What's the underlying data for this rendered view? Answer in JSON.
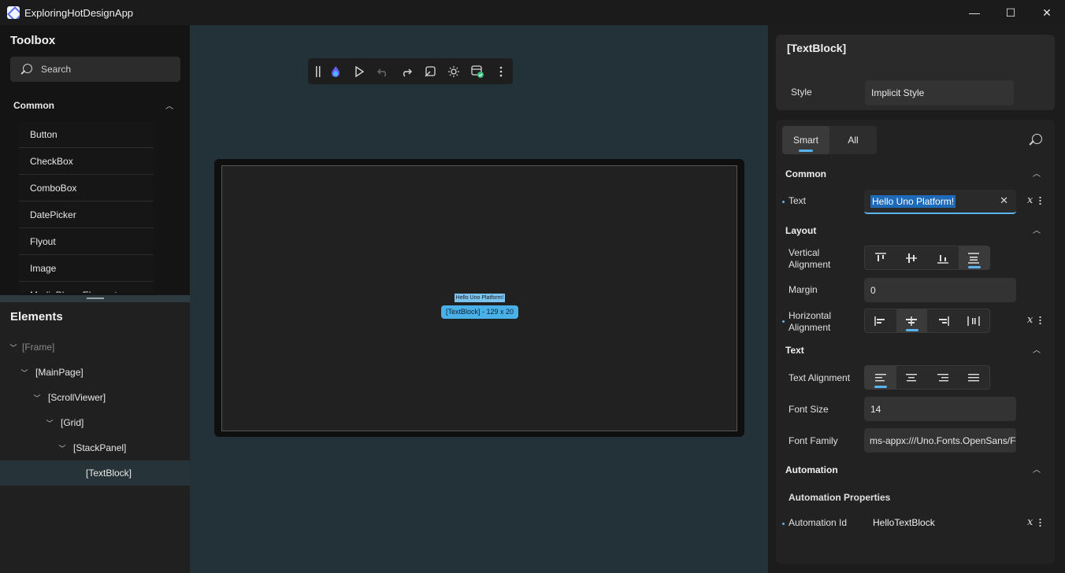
{
  "window": {
    "title": "ExploringHotDesignApp",
    "controls": {
      "minimize": "—",
      "maximize": "☐",
      "close": "✕"
    }
  },
  "toolbox": {
    "title": "Toolbox",
    "search_placeholder": "Search",
    "section": "Common",
    "items": [
      "Button",
      "CheckBox",
      "ComboBox",
      "DatePicker",
      "Flyout",
      "Image",
      "MediaPlayerElement"
    ]
  },
  "elements": {
    "title": "Elements",
    "tree": [
      {
        "label": "[Frame]",
        "depth": 0,
        "expanded": true,
        "dim": true
      },
      {
        "label": "[MainPage]",
        "depth": 1,
        "expanded": true
      },
      {
        "label": "[ScrollViewer]",
        "depth": 2,
        "expanded": true
      },
      {
        "label": "[Grid]",
        "depth": 3,
        "expanded": true
      },
      {
        "label": "[StackPanel]",
        "depth": 4,
        "expanded": true
      },
      {
        "label": "[TextBlock]",
        "depth": 5,
        "selected": true
      }
    ]
  },
  "canvas": {
    "toolbar_icons": [
      "grip-icon",
      "hot-design-flame-icon",
      "play-icon",
      "undo-icon",
      "redo-icon",
      "element-picker-icon",
      "theme-toggle-icon",
      "studio-status-icon",
      "more-icon"
    ],
    "preview_text": "Hello Uno Platform!",
    "selection_tag": "[TextBlock] - 129 x 20"
  },
  "properties": {
    "element_title": "[TextBlock]",
    "style_label": "Style",
    "style_value": "Implicit Style",
    "tabs": [
      "Smart",
      "All"
    ],
    "active_tab": "Smart",
    "groups": {
      "common": "Common",
      "layout": "Layout",
      "text": "Text",
      "automation": "Automation"
    },
    "text_label": "Text",
    "text_value": "Hello Uno Platform!",
    "vertical_alignment_label": "Vertical Alignment",
    "vertical_alignment_value": "Stretch",
    "margin_label": "Margin",
    "margin_value": "0",
    "horizontal_alignment_label": "Horizontal Alignment",
    "horizontal_alignment_value": "Center",
    "text_alignment_label": "Text Alignment",
    "text_alignment_value": "Left",
    "font_size_label": "Font Size",
    "font_size_value": "14",
    "font_family_label": "Font Family",
    "font_family_value": "ms-appx:///Uno.Fonts.OpenSans/Fo",
    "automation_properties_label": "Automation Properties",
    "automation_id_label": "Automation Id",
    "automation_id_value": "HelloTextBlock",
    "binding_symbol": "𝑥"
  },
  "colors": {
    "accent": "#5ab3ec",
    "canvas_bg": "#233139",
    "panel_bg": "#1c1c1c",
    "selection": "#1e6ab8"
  }
}
